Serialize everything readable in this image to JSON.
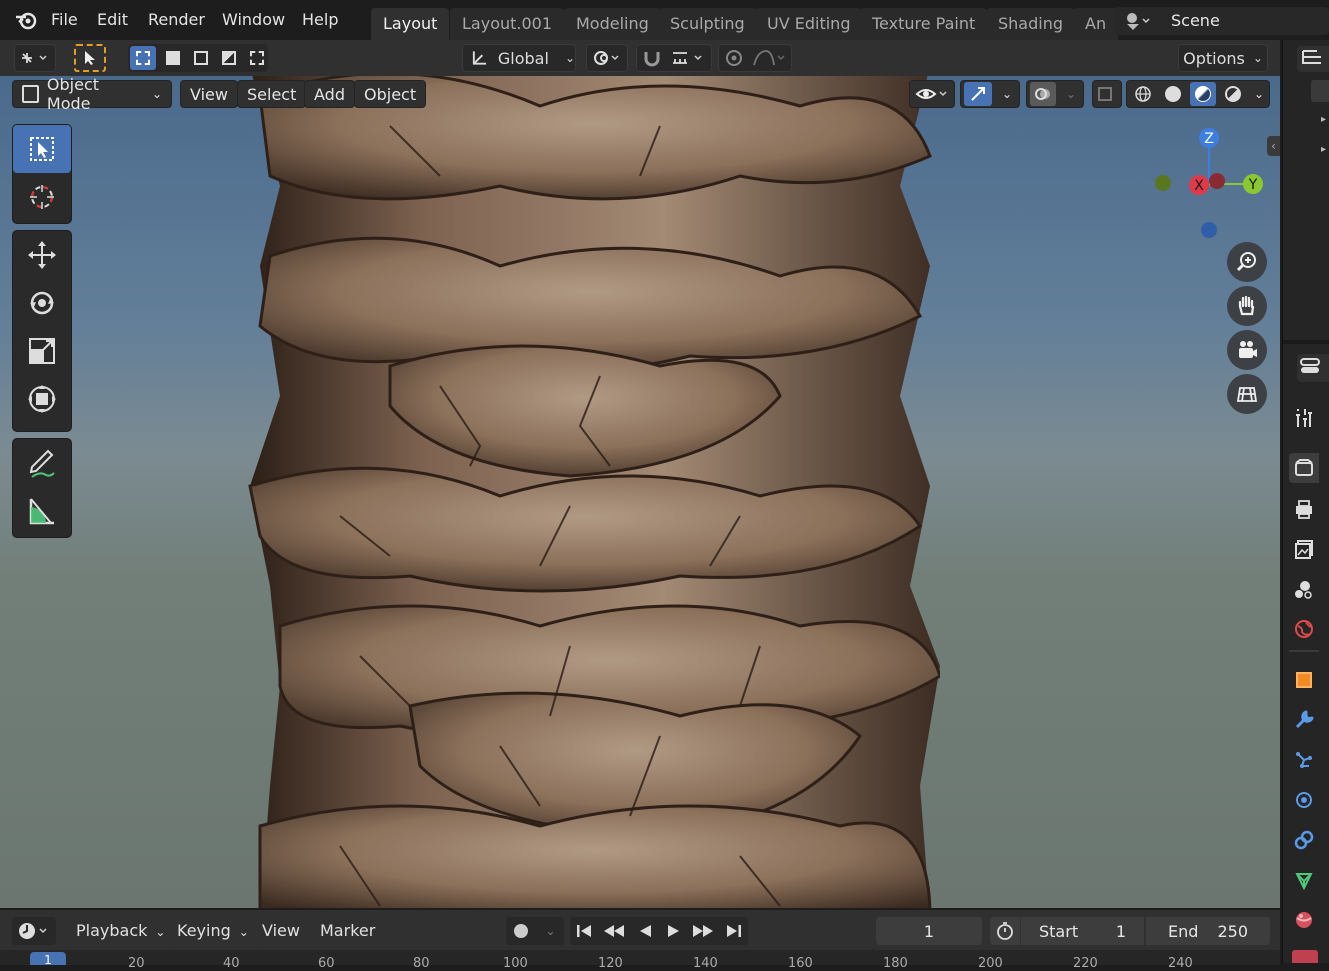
{
  "menus": [
    "File",
    "Edit",
    "Render",
    "Window",
    "Help"
  ],
  "workspaces": [
    "Layout",
    "Layout.001",
    "Modeling",
    "Sculpting",
    "UV Editing",
    "Texture Paint",
    "Shading",
    "An"
  ],
  "active_workspace": "Layout",
  "scene_name": "Scene",
  "header": {
    "orientation": "Global",
    "options_label": "Options"
  },
  "viewport_header": {
    "mode": "Object Mode",
    "menus": [
      "View",
      "Select",
      "Add",
      "Object"
    ]
  },
  "gizmo": {
    "x": "X",
    "y": "Y",
    "z": "Z"
  },
  "timeline": {
    "menus": [
      "Playback",
      "Keying",
      "View",
      "Marker"
    ],
    "current_frame": "1",
    "start_label": "Start",
    "start_value": "1",
    "end_label": "End",
    "end_value": "250",
    "ruler": [
      "1",
      "20",
      "40",
      "60",
      "80",
      "100",
      "120",
      "140",
      "160",
      "180",
      "200",
      "220",
      "240"
    ]
  },
  "colors": {
    "accent": "#4772b3",
    "x_axis": "#e03a4a",
    "y_axis": "#8ac832",
    "z_axis": "#3d7fe0"
  }
}
